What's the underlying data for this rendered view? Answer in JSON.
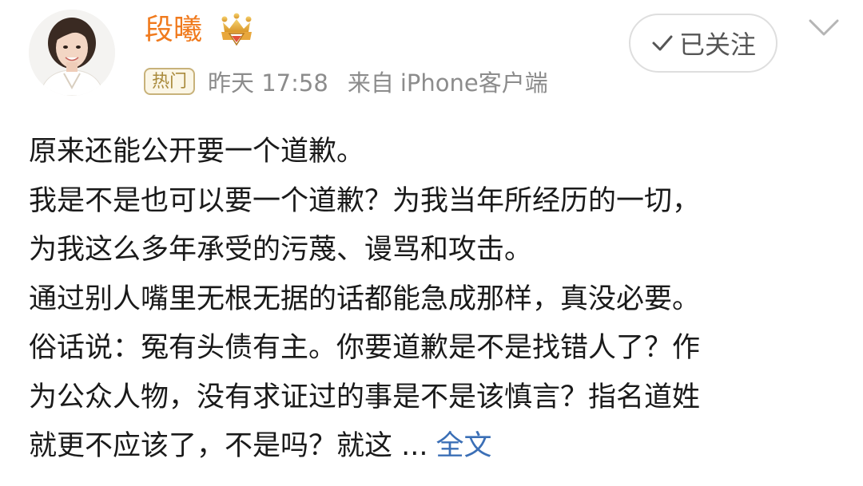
{
  "author": {
    "name": "段曦",
    "avatar_icon": "avatar-photo",
    "badge_icon": "vip-crown-icon"
  },
  "meta": {
    "hot_label": "热门",
    "time": "昨天 17:58",
    "source_prefix": "来自",
    "source": "iPhone客户端"
  },
  "follow": {
    "label": "已关注",
    "icon": "check-icon"
  },
  "menu": {
    "icon": "chevron-down-icon"
  },
  "post": {
    "lines": [
      "原来还能公开要一个道歉。",
      "我是不是也可以要一个道歉？为我当年所经历的一切，",
      "为我这么多年承受的污蔑、谩骂和攻击。",
      "通过别人嘴里无根无据的话都能急成那样，真没必要。",
      "俗话说：冤有头债有主。你要道歉是不是找错人了？作",
      "为公众人物，没有求证过的事是不是该慎言？指名道姓",
      "就更不应该了，不是吗？就这 ..."
    ],
    "expand_label": "全文"
  },
  "colors": {
    "name": "#f07a1d",
    "meta": "#8c8c8c",
    "link": "#3b6fb6",
    "hot_border": "#c8b27a",
    "text": "#1a1a1a"
  }
}
